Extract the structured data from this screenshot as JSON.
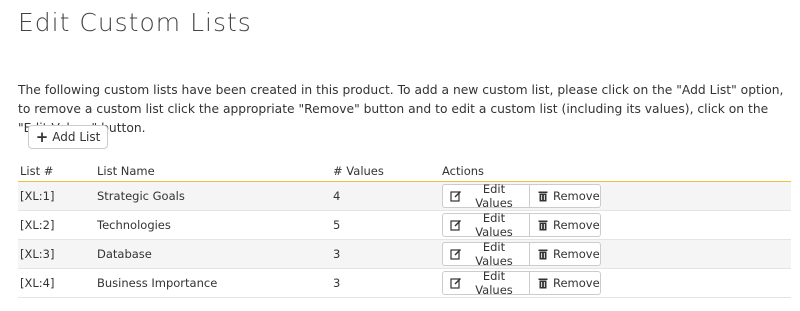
{
  "page": {
    "title": "Edit Custom Lists",
    "intro": "The following custom lists have been created in this product. To add a new custom list, please click on the \"Add List\" option, to remove a custom list click the appropriate \"Remove\" button and to edit a custom list (including its values), click on the \"Edit Values\" button."
  },
  "toolbar": {
    "add_label": "Add List",
    "add_icon": "plus-icon"
  },
  "table": {
    "headers": {
      "num": "List #",
      "name": "List Name",
      "values": "# Values",
      "actions": "Actions"
    },
    "edit_label": "Edit Values",
    "edit_icon": "edit-icon",
    "remove_label": "Remove",
    "remove_icon": "trash-icon",
    "rows": [
      {
        "num": "[XL:1]",
        "name": "Strategic Goals",
        "values": "4"
      },
      {
        "num": "[XL:2]",
        "name": "Technologies",
        "values": "5"
      },
      {
        "num": "[XL:3]",
        "name": "Database",
        "values": "3"
      },
      {
        "num": "[XL:4]",
        "name": "Business Importance",
        "values": "3"
      }
    ]
  },
  "colors": {
    "header_border": "#f0c040",
    "row_alt": "#f5f5f5"
  }
}
